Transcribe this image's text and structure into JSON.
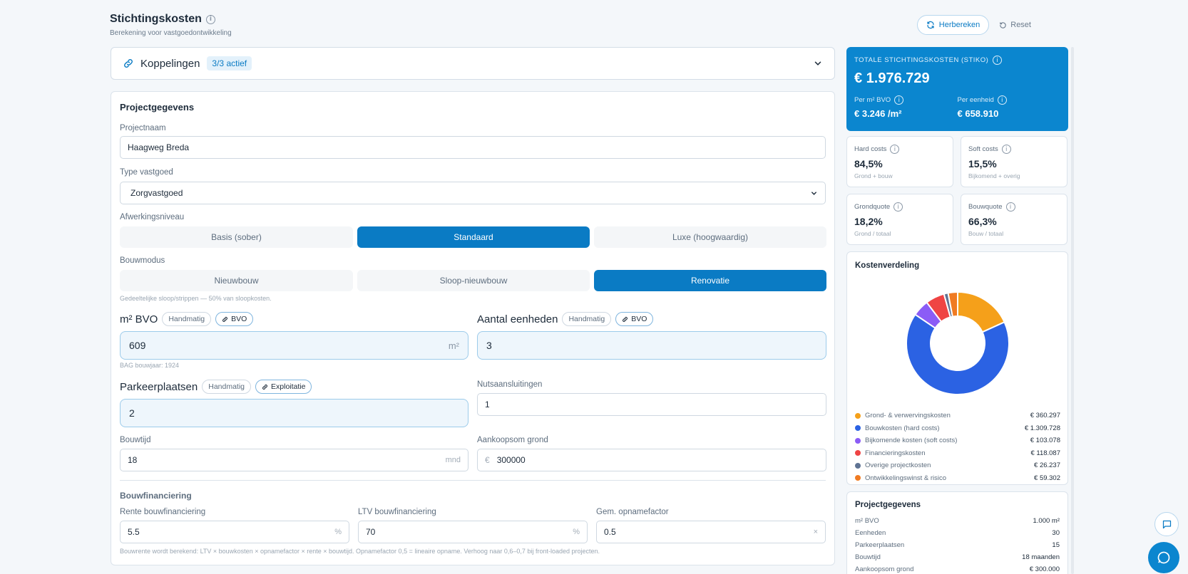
{
  "header": {
    "title": "Stichtingskosten",
    "subtitle": "Berekening voor vastgoedontwikkeling"
  },
  "actions": {
    "recalc_label": "Herbereken",
    "reset_label": "Reset"
  },
  "koppelingen": {
    "label": "Koppelingen",
    "badge": "3/3 actief"
  },
  "form": {
    "section_title": "Projectgegevens",
    "projectnaam_label": "Projectnaam",
    "projectnaam_value": "Haagweg Breda",
    "type_label": "Type vastgoed",
    "type_value": "Zorgvastgoed",
    "afwerking_label": "Afwerkingsniveau",
    "afwerking_options": [
      "Basis (sober)",
      "Standaard",
      "Luxe (hoogwaardig)"
    ],
    "afwerking_selected": "Standaard",
    "bouwmodus_label": "Bouwmodus",
    "bouwmodus_options": [
      "Nieuwbouw",
      "Sloop-nieuwbouw",
      "Renovatie"
    ],
    "bouwmodus_selected": "Renovatie",
    "bouwmodus_hint": "Gedeeltelijke sloop/strippen — 50% van sloopkosten.",
    "bvo_label": "m² BVO",
    "bvo_tag_manual": "Handmatig",
    "bvo_tag_link": "BVO",
    "bvo_value": "609",
    "bvo_unit": "m²",
    "bvo_hint": "BAG bouwjaar: 1924",
    "eenheden_label": "Aantal eenheden",
    "eenheden_tag_manual": "Handmatig",
    "eenheden_tag_link": "BVO",
    "eenheden_value": "3",
    "parkeer_label": "Parkeerplaatsen",
    "parkeer_tag_manual": "Handmatig",
    "parkeer_tag_link": "Exploitatie",
    "parkeer_value": "2",
    "nuts_label": "Nutsaansluitingen",
    "nuts_value": "1",
    "bouwtijd_label": "Bouwtijd",
    "bouwtijd_value": "18",
    "bouwtijd_unit": "mnd",
    "aankoop_label": "Aankoopsom grond",
    "aankoop_prefix": "€",
    "aankoop_value": "300000",
    "fin_title": "Bouwfinanciering",
    "rente_label": "Rente bouwfinanciering",
    "rente_value": "5.5",
    "rente_unit": "%",
    "ltv_label": "LTV bouwfinanciering",
    "ltv_value": "70",
    "ltv_unit": "%",
    "opname_label": "Gem. opnamefactor",
    "opname_value": "0.5",
    "opname_unit": "×",
    "fin_hint": "Bouwrente wordt berekend: LTV × bouwkosten × opnamefactor × rente × bouwtijd. Opnamefactor 0,5 = lineaire opname. Verhoog naar 0,6–0,7 bij front-loaded projecten."
  },
  "totals": {
    "label": "TOTALE STICHTINGSKOSTEN (STIKO)",
    "value": "€ 1.976.729",
    "per_m2_label": "Per m² BVO",
    "per_m2_value": "€ 3.246 /m²",
    "per_unit_label": "Per eenheid",
    "per_unit_value": "€ 658.910"
  },
  "kpis": [
    {
      "label": "Hard costs",
      "value": "84,5%",
      "sub": "Grond + bouw"
    },
    {
      "label": "Soft costs",
      "value": "15,5%",
      "sub": "Bijkomend + overig"
    },
    {
      "label": "Grondquote",
      "value": "18,2%",
      "sub": "Grond / totaal"
    },
    {
      "label": "Bouwquote",
      "value": "66,3%",
      "sub": "Bouw / totaal"
    }
  ],
  "chart_data": {
    "type": "pie",
    "title": "Kostenverdeling",
    "categories": [
      "Grond- & verwervingskosten",
      "Bouwkosten (hard costs)",
      "Bijkomende kosten (soft costs)",
      "Financieringskosten",
      "Overige projectkosten",
      "Ontwikkelingswinst & risico"
    ],
    "values": [
      360297,
      1309728,
      103078,
      118087,
      26237,
      59302
    ],
    "value_labels": [
      "€ 360.297",
      "€ 1.309.728",
      "€ 103.078",
      "€ 118.087",
      "€ 26.237",
      "€ 59.302"
    ],
    "colors": [
      "#f5a01a",
      "#2b62e3",
      "#8b5cf6",
      "#ef4444",
      "#5f7393",
      "#f07b22"
    ],
    "legend": "bottom",
    "donut": true
  },
  "summary": {
    "title": "Projectgegevens",
    "rows": [
      {
        "k": "m² BVO",
        "v": "1.000 m²"
      },
      {
        "k": "Eenheden",
        "v": "30"
      },
      {
        "k": "Parkeerplaatsen",
        "v": "15"
      },
      {
        "k": "Bouwtijd",
        "v": "18 maanden"
      },
      {
        "k": "Aankoopsom grond",
        "v": "€ 300.000"
      }
    ]
  }
}
